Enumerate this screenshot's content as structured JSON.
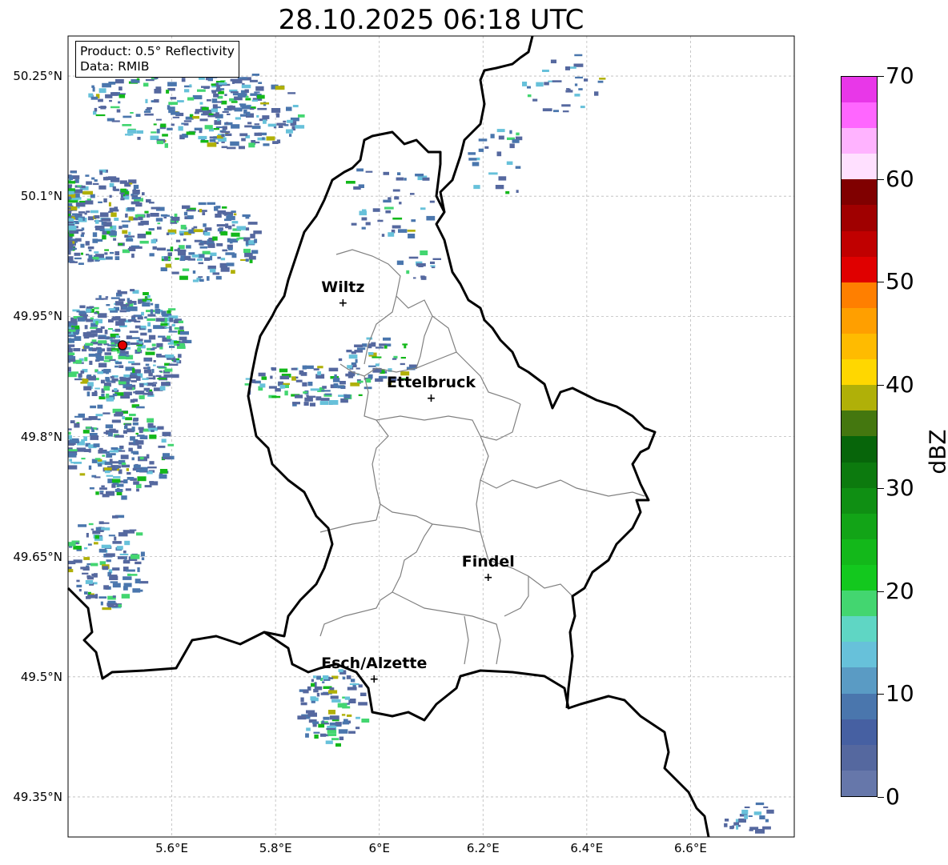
{
  "title": "28.10.2025 06:18 UTC",
  "info": {
    "product": "Product: 0.5° Reflectivity",
    "data": "Data: RMIB"
  },
  "map": {
    "lon_range": [
      5.4,
      6.8
    ],
    "lat_range": [
      49.3,
      50.3
    ],
    "lat_ticks": [
      {
        "value": 50.25,
        "label": "50.25°N"
      },
      {
        "value": 50.1,
        "label": "50.1°N"
      },
      {
        "value": 49.95,
        "label": "49.95°N"
      },
      {
        "value": 49.8,
        "label": "49.8°N"
      },
      {
        "value": 49.65,
        "label": "49.65°N"
      },
      {
        "value": 49.5,
        "label": "49.5°N"
      },
      {
        "value": 49.35,
        "label": "49.35°N"
      }
    ],
    "lon_ticks": [
      {
        "value": 5.6,
        "label": "5.6°E"
      },
      {
        "value": 5.8,
        "label": "5.8°E"
      },
      {
        "value": 6.0,
        "label": "6°E"
      },
      {
        "value": 6.2,
        "label": "6.2°E"
      },
      {
        "value": 6.4,
        "label": "6.4°E"
      },
      {
        "value": 6.6,
        "label": "6.6°E"
      }
    ],
    "cities": [
      {
        "name": "Wiltz",
        "lon": 5.93,
        "lat": 49.966
      },
      {
        "name": "Ettelbruck",
        "lon": 6.1,
        "lat": 49.847
      },
      {
        "name": "Findel",
        "lon": 6.21,
        "lat": 49.624
      },
      {
        "name": "Esch/Alzette",
        "lon": 5.99,
        "lat": 49.497
      }
    ],
    "radar_site": {
      "lon": 5.505,
      "lat": 49.914
    },
    "colors": {
      "border": "#000000",
      "cantons": "#808080",
      "grid": "#bbbbbb",
      "radar_site": "#e00000"
    }
  },
  "colorbar": {
    "unit": "dBZ",
    "ticks": [
      "0",
      "10",
      "20",
      "30",
      "40",
      "50",
      "60",
      "70"
    ],
    "colors": [
      "#6677aa",
      "#55689f",
      "#4660a2",
      "#4a76ad",
      "#5a9bc4",
      "#67c1da",
      "#5fd6c4",
      "#43d670",
      "#13c81e",
      "#13b81a",
      "#12a417",
      "#0f8f13",
      "#0c7a0e",
      "#07650a",
      "#44770f",
      "#b0b008",
      "#ffd700",
      "#ffbb00",
      "#ff9f00",
      "#ff7f00",
      "#e00000",
      "#c00000",
      "#a00000",
      "#800000",
      "#ffe0ff",
      "#ffb3ff",
      "#ff66ff",
      "#e837e8"
    ]
  }
}
